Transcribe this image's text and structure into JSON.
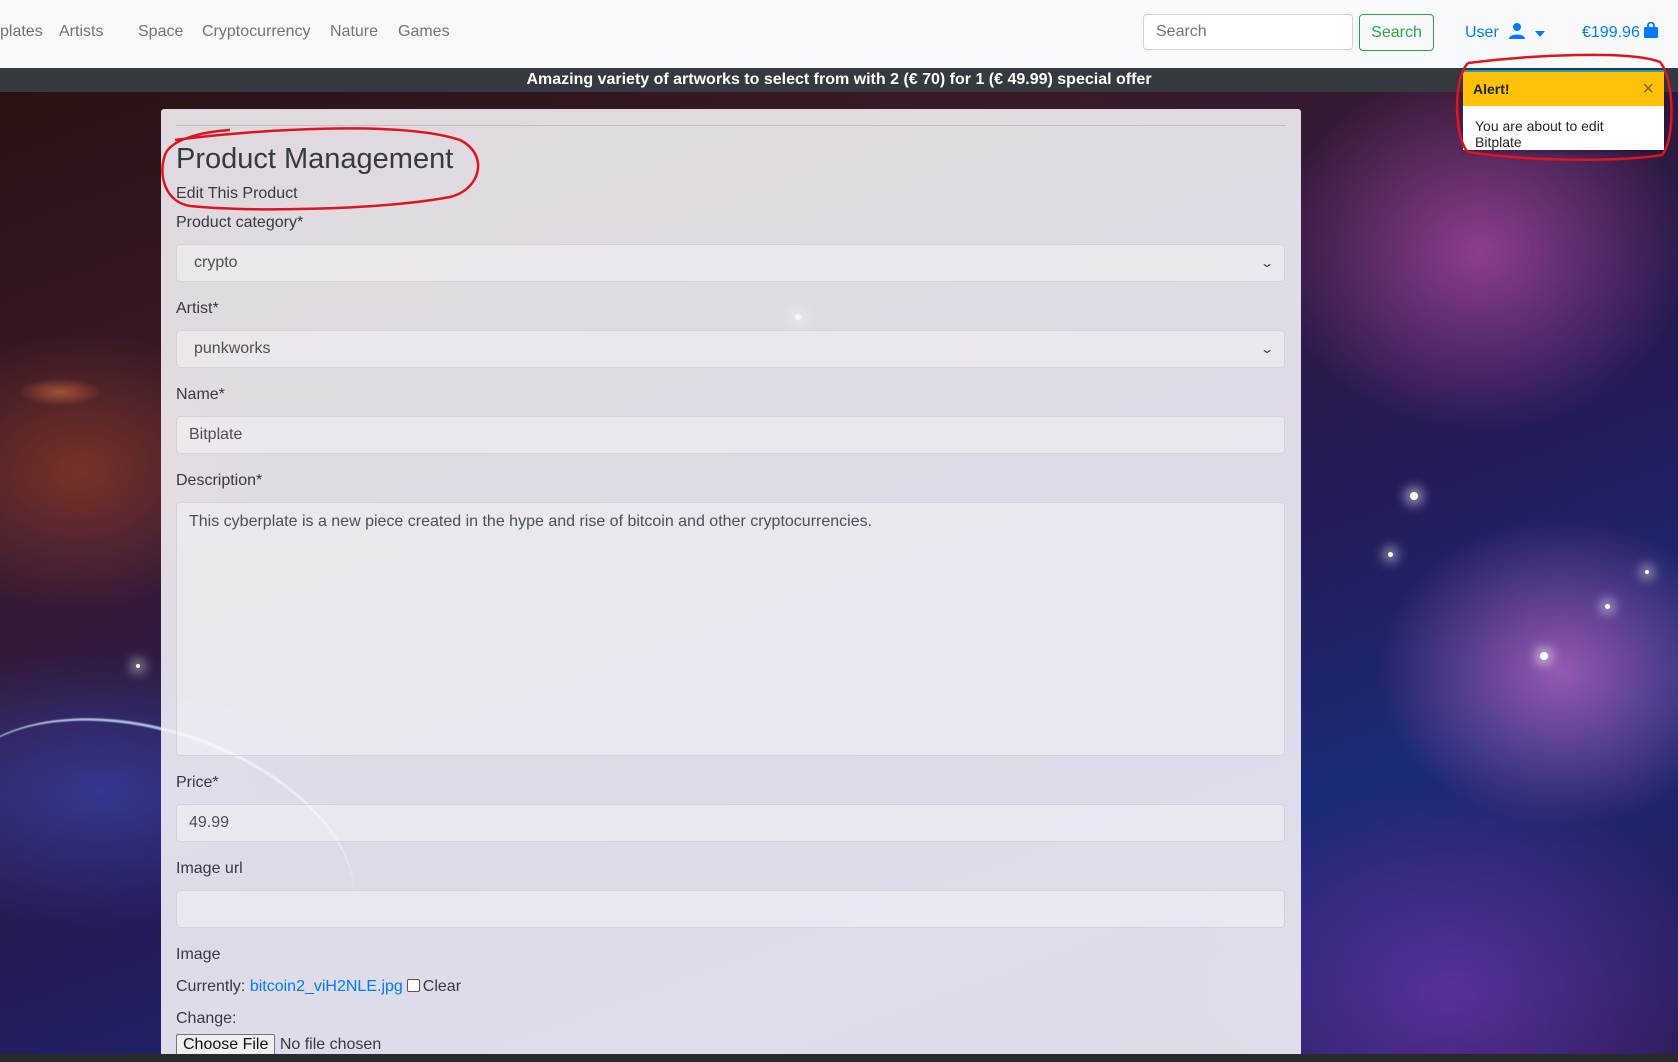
{
  "nav": {
    "links": [
      "plates",
      "Artists",
      "Space",
      "Cryptocurrency",
      "Nature",
      "Games"
    ],
    "search_placeholder": "Search",
    "search_button": "Search",
    "user_label": "User",
    "bag_total": "€199.96"
  },
  "banner": {
    "text": "Amazing variety of artworks to select from with 2 (€ 70) for 1 (€ 49.99) special offer"
  },
  "toast": {
    "title": "Alert!",
    "close": "×",
    "message": "You are about to edit Bitplate"
  },
  "form": {
    "title": "Product Management",
    "subtitle": "Edit This Product",
    "category_label": "Product category*",
    "category_value": "crypto",
    "artist_label": "Artist*",
    "artist_value": "punkworks",
    "name_label": "Name*",
    "name_value": "Bitplate",
    "description_label": "Description*",
    "description_value": "This cyberplate is a new piece created in the hype and rise of bitcoin and other cryptocurrencies.",
    "price_label": "Price*",
    "price_value": "49.99",
    "image_url_label": "Image url",
    "image_url_value": "",
    "image_label": "Image",
    "currently_label": "Currently:",
    "current_file": "bitcoin2_viH2NLE.jpg",
    "clear_label": "Clear",
    "change_label": "Change:",
    "choose_file_button": "Choose File",
    "no_file_text": "No file chosen"
  },
  "colors": {
    "annotation": "#e0141e",
    "toast_header": "#ffc107",
    "link": "#007bff",
    "search_button": "#28a745"
  }
}
